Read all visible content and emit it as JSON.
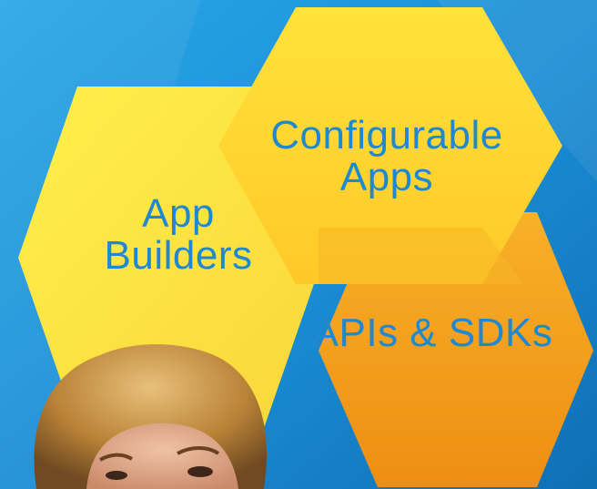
{
  "hexagons": [
    {
      "id": "configurable",
      "line1": "Configurable",
      "line2": "Apps",
      "fill": "#FFD92E"
    },
    {
      "id": "builders",
      "line1": "App",
      "line2": "Builders",
      "fill": "#FFE838"
    },
    {
      "id": "apis",
      "line1": "APIs & SDKs",
      "fill": "#F7A21B"
    }
  ],
  "colors": {
    "background": "#1C8FD6",
    "label_text": "#1E88D0",
    "hair": "#C8923E",
    "skin": "#D9A485"
  }
}
